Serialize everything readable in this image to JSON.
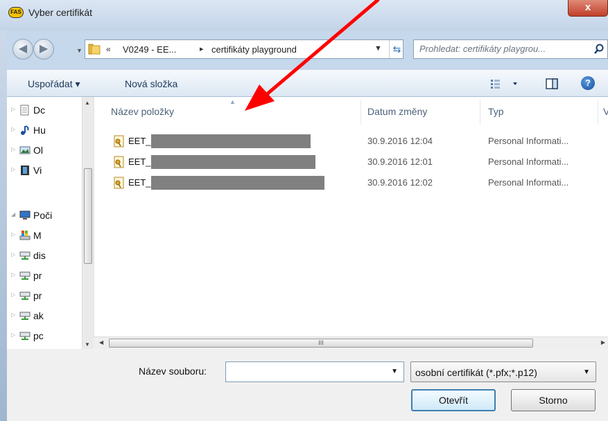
{
  "window": {
    "title": "Vyber certifikát",
    "app_logo_text": "FAS",
    "close_label": "x"
  },
  "address": {
    "chevrons": "«",
    "segments": [
      "V0249 - EE...",
      "certifikáty playground"
    ],
    "separator": "▸",
    "search_placeholder": "Prohledat: certifikáty playgrou..."
  },
  "toolbar": {
    "organize_label": "Uspořádat ▾",
    "new_folder_label": "Nová složka",
    "help_label": "?"
  },
  "nav": {
    "items": [
      {
        "label": "Dc",
        "icon": "documents-icon"
      },
      {
        "label": "Hu",
        "icon": "music-icon"
      },
      {
        "label": "Ol",
        "icon": "pictures-icon"
      },
      {
        "label": "Vi",
        "icon": "videos-icon"
      },
      {
        "label": "Poči",
        "icon": "computer-icon"
      },
      {
        "label": "M",
        "icon": "windows-drive-icon"
      },
      {
        "label": "dis",
        "icon": "network-drive-icon"
      },
      {
        "label": "pr",
        "icon": "network-drive-icon"
      },
      {
        "label": "pr",
        "icon": "network-drive-icon"
      },
      {
        "label": "ak",
        "icon": "network-drive-icon"
      },
      {
        "label": "pc",
        "icon": "network-drive-icon"
      }
    ]
  },
  "columns": {
    "name": "Název položky",
    "date": "Datum změny",
    "type": "Typ",
    "size": "V"
  },
  "files": [
    {
      "name": "EET_",
      "date": "30.9.2016 12:04",
      "type": "Personal Informati..."
    },
    {
      "name": "EET_",
      "date": "30.9.2016 12:01",
      "type": "Personal Informati..."
    },
    {
      "name": "EET_",
      "date": "30.9.2016 12:02",
      "type": "Personal Informati..."
    }
  ],
  "bottom": {
    "filename_label": "Název souboru:",
    "filename_value": "",
    "filter_value": "osobní certifikát (*.pfx;*.p12)",
    "open_label": "Otevřít",
    "cancel_label": "Storno"
  },
  "hscroll_grip": "III",
  "colors": {
    "annotation_arrow": "#ff0000",
    "redaction": "#808080",
    "accent": "#3c7fb1"
  }
}
